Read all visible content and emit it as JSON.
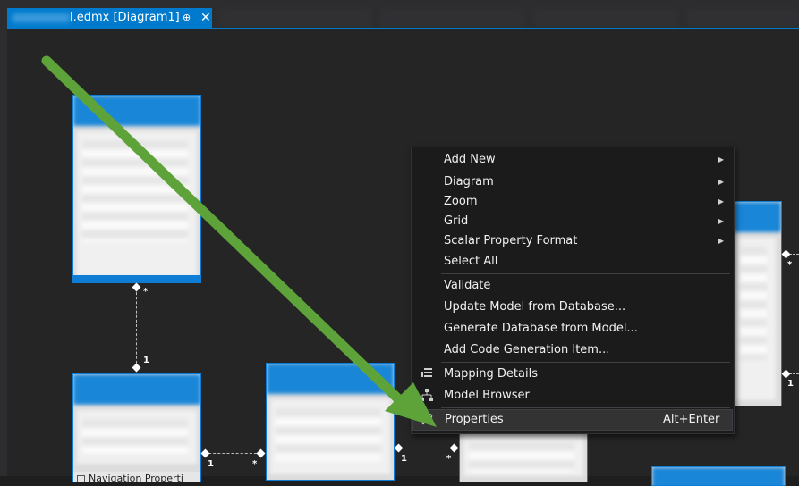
{
  "tabs": {
    "active": {
      "title": "l.edmx [Diagram1]",
      "pin": "⊕",
      "close": "✕"
    }
  },
  "diagram": {
    "entities": [
      {
        "navigation_label": ""
      },
      {
        "navigation_label": "Navigation Properti"
      }
    ],
    "multiplicities": {
      "top_star": "*",
      "top_one": "1",
      "mid_one": "1",
      "mid_star": "*",
      "right_one": "1",
      "right_star": "*",
      "far_star": "*",
      "far_one": "1"
    }
  },
  "context_menu": {
    "add_new": "Add New",
    "diagram": "Diagram",
    "zoom": "Zoom",
    "grid": "Grid",
    "scalar_property_format": "Scalar Property Format",
    "select_all": "Select All",
    "validate": "Validate",
    "update_model": "Update Model from Database...",
    "generate_database": "Generate Database from Model...",
    "add_code_generation": "Add Code Generation Item...",
    "mapping_details": "Mapping Details",
    "model_browser": "Model Browser",
    "properties": "Properties",
    "properties_shortcut": "Alt+Enter"
  },
  "colors": {
    "accent": "#007acc",
    "arrow": "#5ea33a",
    "menu_bg": "#1b1b1c"
  },
  "icons": {
    "submenu": "triangle-right",
    "mapping": "mapping-details-icon",
    "browser": "model-browser-icon",
    "properties": "wrench-icon"
  }
}
